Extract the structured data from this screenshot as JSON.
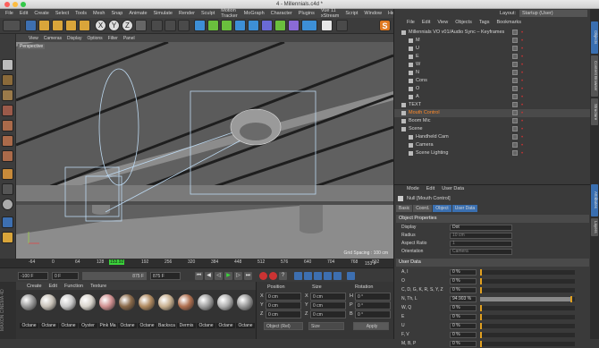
{
  "window": {
    "title": "4 - Millennials.c4d *"
  },
  "menu": [
    "File",
    "Edit",
    "Create",
    "Select",
    "Tools",
    "Mesh",
    "Snap",
    "Animate",
    "Simulate",
    "Render",
    "Sculpt",
    "Motion Tracker",
    "MoGraph",
    "Character",
    "Plugins",
    "Vue 11 xStream",
    "Script",
    "Window",
    "Help"
  ],
  "layout": {
    "label": "Layout:",
    "value": "Startup (User)"
  },
  "viewport": {
    "menu": [
      "View",
      "Cameras",
      "Display",
      "Options",
      "Filter",
      "Panel"
    ],
    "camera_label": "Perspective",
    "grid_spacing": "Grid Spacing : 100 cm"
  },
  "timeline": {
    "ticks": [
      "-64",
      "0",
      "64",
      "128",
      "153.92",
      "192",
      "256",
      "320",
      "384",
      "448",
      "512",
      "576",
      "640",
      "704",
      "768",
      "832"
    ],
    "end_label": "153 F"
  },
  "transport": {
    "start": "-100 F",
    "current": "0 F",
    "end_small": "875 F",
    "end": "875 F"
  },
  "materials": {
    "menu": [
      "Create",
      "Edit",
      "Function",
      "Texture"
    ],
    "items": [
      {
        "label": "Octane",
        "color": "#9a9a9a"
      },
      {
        "label": "Octane",
        "color": "#c8c2b8"
      },
      {
        "label": "Octane",
        "color": "#c9c9c9"
      },
      {
        "label": "Oyster",
        "color": "#d8d4cc"
      },
      {
        "label": "Pink Ma",
        "color": "#d09090"
      },
      {
        "label": "Octane",
        "color": "#8a6a4a"
      },
      {
        "label": "Octane",
        "color": "#b08a60"
      },
      {
        "label": "Backsca",
        "color": "#c8b090"
      },
      {
        "label": "Dermis",
        "color": "#b07050"
      },
      {
        "label": "Octane",
        "color": "#a0a0a0"
      },
      {
        "label": "Octane",
        "color": "#b0b0b0"
      },
      {
        "label": "Octane",
        "color": "#999999"
      }
    ]
  },
  "coords": {
    "headers": [
      "Position",
      "Size",
      "Rotation"
    ],
    "rows": [
      {
        "a": "X",
        "av": "0 cm",
        "b": "X",
        "bv": "0 cm",
        "c": "H",
        "cv": "0 °"
      },
      {
        "a": "Y",
        "av": "0 cm",
        "b": "Y",
        "bv": "0 cm",
        "c": "P",
        "cv": "0 °"
      },
      {
        "a": "Z",
        "av": "0 cm",
        "b": "Z",
        "bv": "0 cm",
        "c": "B",
        "cv": "0 °"
      }
    ],
    "mode1": "Object (Rel)",
    "mode2": "Size",
    "apply": "Apply"
  },
  "object_manager": {
    "menu": [
      "File",
      "Edit",
      "View",
      "Objects",
      "Tags",
      "Bookmarks"
    ],
    "objects": [
      {
        "name": "Millennials VO v01/Audio Sync – Keyframes",
        "indent": 0,
        "color": "#d4d4d4"
      },
      {
        "name": "M",
        "indent": 1,
        "color": "#d4d4d4"
      },
      {
        "name": "U",
        "indent": 1,
        "color": "#d4d4d4"
      },
      {
        "name": "E",
        "indent": 1,
        "color": "#d4d4d4"
      },
      {
        "name": "W",
        "indent": 1,
        "color": "#d4d4d4"
      },
      {
        "name": "N",
        "indent": 1,
        "color": "#d4d4d4"
      },
      {
        "name": "Cons",
        "indent": 1,
        "color": "#d4d4d4"
      },
      {
        "name": "O",
        "indent": 1,
        "color": "#d4d4d4"
      },
      {
        "name": "A",
        "indent": 1,
        "color": "#d4d4d4"
      },
      {
        "name": "TEXT",
        "indent": 0,
        "color": "#d4d4d4"
      },
      {
        "name": "Mouth Control",
        "indent": 0,
        "color": "#ff8a2a"
      },
      {
        "name": "Boom Mic",
        "indent": 0,
        "color": "#d4d4d4"
      },
      {
        "name": "Scene",
        "indent": 0,
        "color": "#d4d4d4"
      },
      {
        "name": "Handheld Cam",
        "indent": 1,
        "color": "#d4d4d4"
      },
      {
        "name": "Camera",
        "indent": 1,
        "color": "#d4d4d4"
      },
      {
        "name": "Scene Lighting",
        "indent": 1,
        "color": "#d4d4d4"
      }
    ]
  },
  "attributes": {
    "menu": [
      "Mode",
      "Edit",
      "User Data"
    ],
    "title": "Null [Mouth Control]",
    "tabs": [
      "Basic",
      "Coord.",
      "Object",
      "User Data"
    ],
    "active_tab": "Object",
    "object_props": "Object Properties",
    "props": [
      {
        "label": "Display",
        "value": "Dot"
      },
      {
        "label": "Radius",
        "value": "10 cm"
      },
      {
        "label": "Aspect Ratio",
        "value": "1"
      },
      {
        "label": "Orientation",
        "value": "Camera"
      }
    ],
    "user_data": "User Data",
    "user_rows": [
      {
        "label": "A, I",
        "value": "0 %",
        "fill": 0.0
      },
      {
        "label": "O",
        "value": "0 %",
        "fill": 0.0
      },
      {
        "label": "C, D, G, K, R, S, Y, Z",
        "value": "0 %",
        "fill": 0.0
      },
      {
        "label": "N, Th, L",
        "value": "94.903 %",
        "fill": 0.949
      },
      {
        "label": "W, Q",
        "value": "0 %",
        "fill": 0.0
      },
      {
        "label": "E",
        "value": "0 %",
        "fill": 0.0
      },
      {
        "label": "U",
        "value": "0 %",
        "fill": 0.0
      },
      {
        "label": "F, V",
        "value": "0 %",
        "fill": 0.0
      },
      {
        "label": "M, B, P",
        "value": "0 %",
        "fill": 0.0
      }
    ]
  },
  "side_tabs": [
    "Objects",
    "Content Browser",
    "Structure",
    "Attributes",
    "Layers"
  ]
}
